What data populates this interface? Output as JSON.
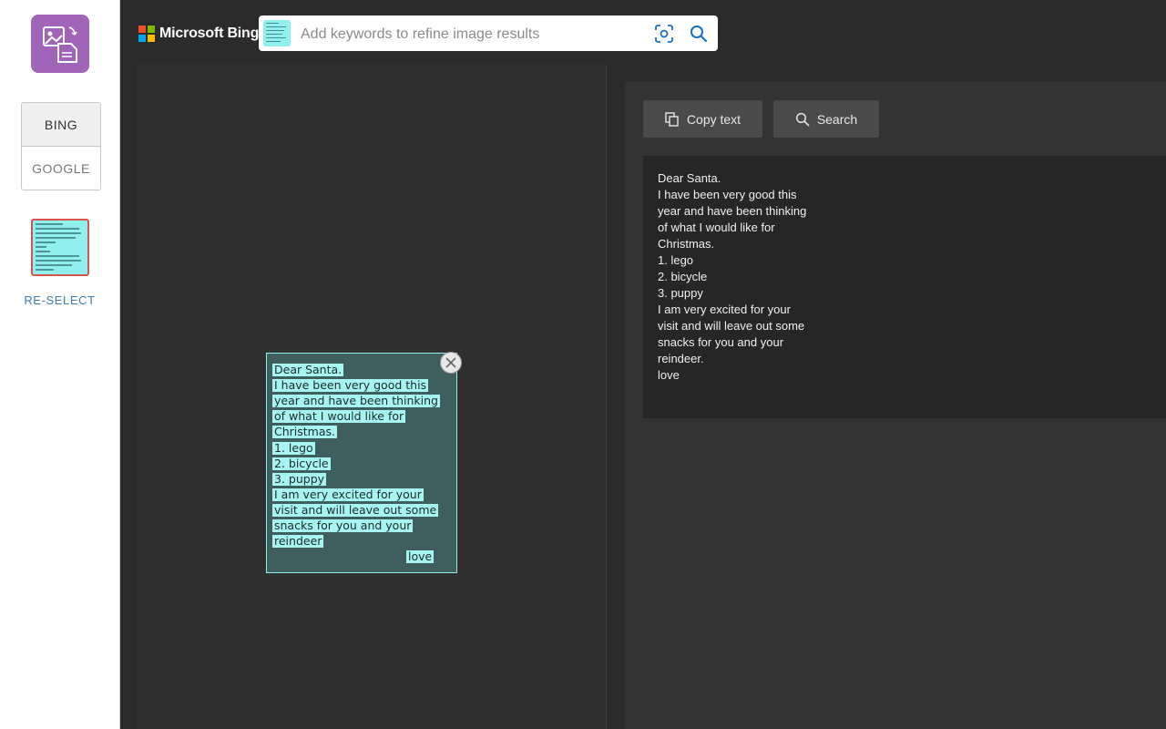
{
  "sidebar": {
    "app_icon": "image-to-text-icon",
    "engines": [
      {
        "label": "BING",
        "active": true
      },
      {
        "label": "GOOGLE",
        "active": false
      }
    ],
    "reselect_label": "RE-SELECT"
  },
  "topbar": {
    "brand": "Microsoft Bing",
    "search_placeholder": "Add keywords to refine image results",
    "search_value": ""
  },
  "note": {
    "lines": [
      "Dear Santa.",
      "I have been very good this",
      "year and have been thinking",
      "of what I would like for",
      "Christmas.",
      "1. lego",
      "2. bicycle",
      "3. puppy",
      "I am very excited for your",
      "visit and will leave out some",
      "snacks for you and your",
      "reindeer",
      "love"
    ]
  },
  "actions": {
    "copy_label": "Copy text",
    "search_label": "Search"
  },
  "result": {
    "lines": [
      "Dear Santa.",
      "I have been very good this",
      "year and have been thinking",
      "of what I would like for",
      "Christmas.",
      "1. lego",
      "2. bicycle",
      "3. puppy",
      "I am very excited for your",
      "visit and will leave out some",
      "snacks for you and your",
      "reindeer.",
      "love"
    ]
  },
  "colors": {
    "accent_purple": "#a064b8",
    "link_blue": "#3a7cb8",
    "highlight_cyan": "#a6f5f1",
    "selection_border": "#d9534f"
  }
}
